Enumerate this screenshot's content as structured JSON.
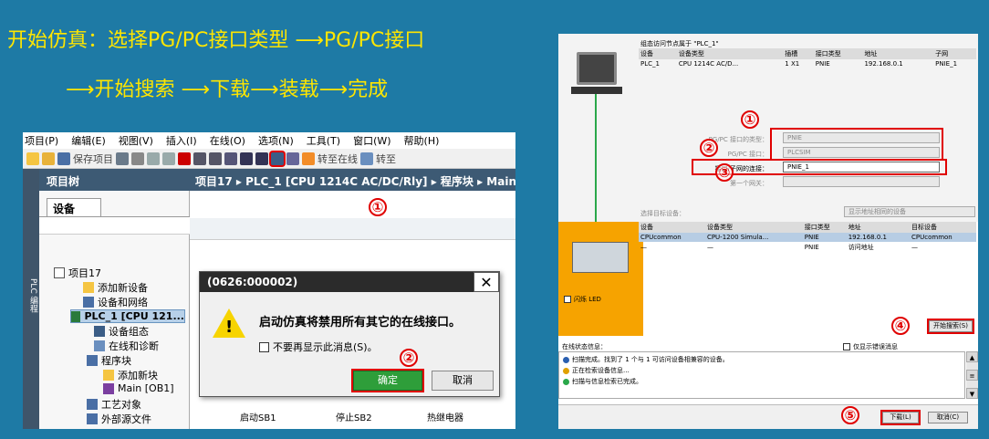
{
  "headline": {
    "line1": "开始仿真：选择PG/PC接口类型 ⟶PG/PC接口",
    "line2": "⟶开始搜索 ⟶下载⟶装载⟶完成"
  },
  "markers": {
    "one": "①",
    "two": "②",
    "three": "③",
    "four": "④",
    "five": "⑤"
  },
  "left": {
    "menu": [
      "项目(P)",
      "编辑(E)",
      "视图(V)",
      "插入(I)",
      "在线(O)",
      "选项(N)",
      "工具(T)",
      "窗口(W)",
      "帮助(H)"
    ],
    "toolbar": {
      "save_label": "保存项目",
      "go_online": "转至在线",
      "go_offline": "转至"
    },
    "side_tab": "PLC 编程",
    "tree_title": "项目树",
    "tree_tab": "设备",
    "tree": [
      "项目17",
      "添加新设备",
      "设备和网络",
      "PLC_1 [CPU 121...",
      "设备组态",
      "在线和诊断",
      "程序块",
      "添加新块",
      "Main [OB1]",
      "工艺对象",
      "外部源文件"
    ],
    "breadcrumb": "项目17 ▸ PLC_1 [CPU 1214C AC/DC/Rly] ▸ 程序块 ▸ Main",
    "ladder": [
      "启动SB1",
      "停止SB2",
      "热继电器"
    ],
    "dialog": {
      "title": "(0626:000002)",
      "close": "✕",
      "message": "启动仿真将禁用所有其它的在线接口。",
      "checkbox": "不要再显示此消息(S)。",
      "ok": "确定",
      "cancel": "取消"
    }
  },
  "right": {
    "caption": "组态访问节点属于 \"PLC_1\"",
    "top_headers": [
      "设备",
      "设备类型",
      "插槽",
      "接口类型",
      "地址",
      "子网"
    ],
    "top_row": [
      "PLC_1",
      "CPU 1214C AC/D...",
      "1 X1",
      "PNIE",
      "192.168.0.1",
      "PNIE_1"
    ],
    "form": {
      "type_label": "PG/PC 接口的类型：",
      "type_value": "PNIE",
      "iface_label": "PG/PC 接口：",
      "iface_value": "PLCSIM",
      "conn_label": "接口/子网的连接：",
      "conn_value": "PNIE_1",
      "gateway_label": "第一个网关："
    },
    "target_label": "选择目标设备：",
    "target_filter": "显示地址相同的设备",
    "target_headers": [
      "设备",
      "设备类型",
      "接口类型",
      "地址",
      "目标设备"
    ],
    "target_rows": [
      [
        "CPUcommon",
        "CPU-1200 Simula...",
        "PNIE",
        "192.168.0.1",
        "CPUcommon"
      ],
      [
        "—",
        "—",
        "PNIE",
        "访问地址",
        "—"
      ]
    ],
    "flash_led": "闪烁 LED",
    "start_search": "开始搜索(S)",
    "status_label": "在线状态信息：",
    "errors_only": "仅显示错误消息",
    "status_lines": [
      "扫描完成。找到了 1 个与 1 可访问设备相兼容的设备。",
      "正在检索设备信息...",
      "扫描与信息检索已完成。"
    ],
    "download": "下载(L)",
    "cancel": "取消(C)"
  }
}
